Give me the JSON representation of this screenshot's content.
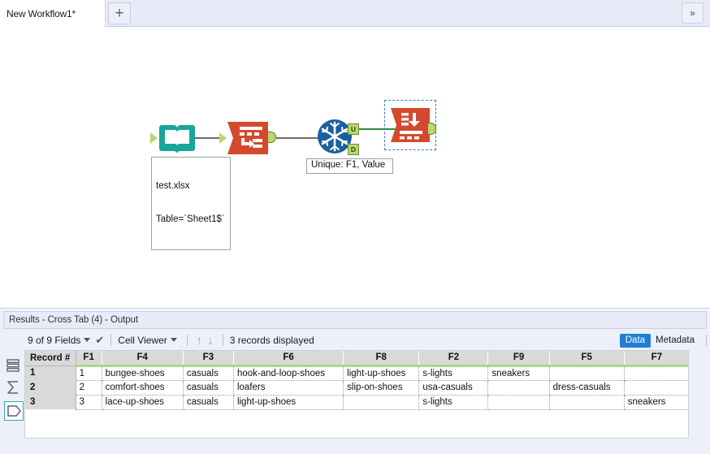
{
  "window": {
    "expand_button_label": "»",
    "new_tab_label": "+"
  },
  "tabs": [
    {
      "label": "New Workflow1*",
      "close_label": "×",
      "active": true
    }
  ],
  "canvas": {
    "nodes": [
      {
        "id": "input-data",
        "name": "input-data-tool",
        "icon": "book-icon",
        "color": "#1aa59a"
      },
      {
        "id": "transpose",
        "name": "transpose-tool",
        "icon": "transpose-icon",
        "color": "#d4492e"
      },
      {
        "id": "unique",
        "name": "unique-tool",
        "icon": "snowflake-icon",
        "color": "#1c5f9e"
      },
      {
        "id": "crosstab",
        "name": "crosstab-tool",
        "icon": "crosstab-icon",
        "color": "#d4492e",
        "selected": true
      }
    ],
    "annotations": [
      {
        "name": "input-data-annotation",
        "line1": "test.xlsx",
        "line2": "Table=`Sheet1$`"
      },
      {
        "name": "unique-annotation",
        "line1": "Unique: F1, Value"
      }
    ],
    "port_labels": {
      "unique_unique": "U",
      "unique_duplicate": "D"
    }
  },
  "results": {
    "title": "Results - Cross Tab (4) - Output",
    "toolbar": {
      "fields_label": "9 of 9 Fields",
      "viewer_label": "Cell Viewer",
      "records_label": "3 records displayed",
      "up_arrow": "↑",
      "down_arrow": "↓",
      "check": "✔",
      "data_tab": "Data",
      "metadata_tab": "Metadata"
    },
    "rail": [
      {
        "name": "rail-icon-data",
        "icon": "rows-icon",
        "selected": false
      },
      {
        "name": "rail-icon-summary",
        "icon": "sigma-icon",
        "selected": false
      },
      {
        "name": "rail-icon-profile",
        "icon": "hexagon-icon",
        "selected": true
      }
    ],
    "table": {
      "columns": [
        "Record #",
        "F1",
        "F4",
        "F3",
        "F6",
        "F8",
        "F2",
        "F9",
        "F5",
        "F7"
      ],
      "rows": [
        {
          "record": "1",
          "cells": [
            "1",
            "bungee-shoes",
            "casuals",
            "hook-and-loop-shoes",
            "light-up-shoes",
            "s-lights",
            "sneakers",
            "",
            ""
          ]
        },
        {
          "record": "2",
          "cells": [
            "2",
            "comfort-shoes",
            "casuals",
            "loafers",
            "slip-on-shoes",
            "usa-casuals",
            "",
            "dress-casuals",
            ""
          ]
        },
        {
          "record": "3",
          "cells": [
            "3",
            "lace-up-shoes",
            "casuals",
            "light-up-shoes",
            "",
            "s-lights",
            "",
            "",
            "sneakers"
          ]
        }
      ]
    }
  },
  "colors": {
    "accent_blue": "#1e7fd4",
    "header_green": "#a8d98a",
    "tool_red": "#d4492e",
    "tool_teal": "#1aa59a",
    "tool_blue": "#1c5f9e",
    "port_green": "#b7d96b",
    "chrome": "#e8ebf7"
  }
}
